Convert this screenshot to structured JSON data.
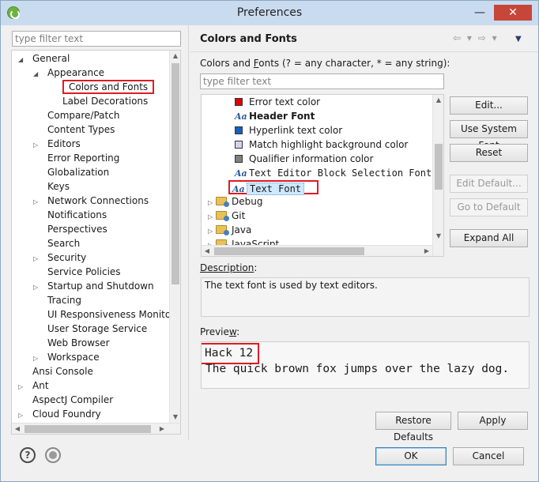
{
  "window": {
    "title": "Preferences",
    "minimize_glyph": "—",
    "close_glyph": "✕"
  },
  "sidebar": {
    "filter_placeholder": "type filter text",
    "items": [
      {
        "label": "General",
        "twisty": "expanded"
      },
      {
        "label": "Appearance",
        "twisty": "expanded"
      },
      {
        "label": "Colors and Fonts",
        "twisty": "none",
        "selected": true
      },
      {
        "label": "Label Decorations",
        "twisty": "none"
      },
      {
        "label": "Compare/Patch",
        "twisty": "none"
      },
      {
        "label": "Content Types",
        "twisty": "none"
      },
      {
        "label": "Editors",
        "twisty": "collapsed"
      },
      {
        "label": "Error Reporting",
        "twisty": "none"
      },
      {
        "label": "Globalization",
        "twisty": "none"
      },
      {
        "label": "Keys",
        "twisty": "none"
      },
      {
        "label": "Network Connections",
        "twisty": "collapsed"
      },
      {
        "label": "Notifications",
        "twisty": "none"
      },
      {
        "label": "Perspectives",
        "twisty": "none"
      },
      {
        "label": "Search",
        "twisty": "none"
      },
      {
        "label": "Security",
        "twisty": "collapsed"
      },
      {
        "label": "Service Policies",
        "twisty": "none"
      },
      {
        "label": "Startup and Shutdown",
        "twisty": "collapsed"
      },
      {
        "label": "Tracing",
        "twisty": "none"
      },
      {
        "label": "UI Responsiveness Monitoring",
        "twisty": "none"
      },
      {
        "label": "User Storage Service",
        "twisty": "none"
      },
      {
        "label": "Web Browser",
        "twisty": "none"
      },
      {
        "label": "Workspace",
        "twisty": "collapsed"
      },
      {
        "label": "Ansi Console",
        "twisty": "none"
      },
      {
        "label": "Ant",
        "twisty": "collapsed"
      },
      {
        "label": "AspectJ Compiler",
        "twisty": "none"
      },
      {
        "label": "Cloud Foundry",
        "twisty": "collapsed"
      }
    ]
  },
  "page": {
    "title": "Colors and Fonts",
    "nav_back_glyph": "⇦ ▾",
    "nav_forward_glyph": "⇨ ▾",
    "view_menu_glyph": "▼",
    "colors_label_pre": "Colors and ",
    "colors_label_key": "F",
    "colors_label_post": "onts (? = any character, * = any string):",
    "filter_placeholder": "type filter text",
    "tree_items": [
      {
        "label": "Error text color",
        "kind": "color",
        "color": "#e00000"
      },
      {
        "label": "Header Font",
        "kind": "font",
        "bold": true
      },
      {
        "label": "Hyperlink text color",
        "kind": "color",
        "color": "#1560bd"
      },
      {
        "label": "Match highlight background color",
        "kind": "color",
        "color": "#d6d0f0"
      },
      {
        "label": "Qualifier information color",
        "kind": "color",
        "color": "#808080"
      },
      {
        "label": "Text Editor Block Selection Font",
        "kind": "font",
        "mono": true
      },
      {
        "label": "Text Font",
        "kind": "font",
        "mono": true,
        "selected": true
      },
      {
        "label": "Debug",
        "kind": "folder"
      },
      {
        "label": "Git",
        "kind": "folder"
      },
      {
        "label": "Java",
        "kind": "folder"
      },
      {
        "label": "JavaScript",
        "kind": "folder"
      }
    ],
    "buttons": {
      "edit": "Edit...",
      "use_system_font": "Use System Font",
      "reset": "Reset",
      "edit_default": "Edit Default...",
      "go_to_default": "Go to Default",
      "expand_all": "Expand All"
    },
    "description_label_pre": "Description",
    "description_label_post": ":",
    "description_text": "The text font is used by text editors.",
    "preview_label_pre": "Previe",
    "preview_label_key": "w",
    "preview_label_post": ":",
    "preview_font_name": "Hack 12",
    "preview_sample": "The quick brown fox jumps over the lazy dog.",
    "restore_defaults": "Restore Defaults",
    "apply": "Apply"
  },
  "footer": {
    "help_glyph": "?",
    "ok": "OK",
    "cancel": "Cancel"
  }
}
